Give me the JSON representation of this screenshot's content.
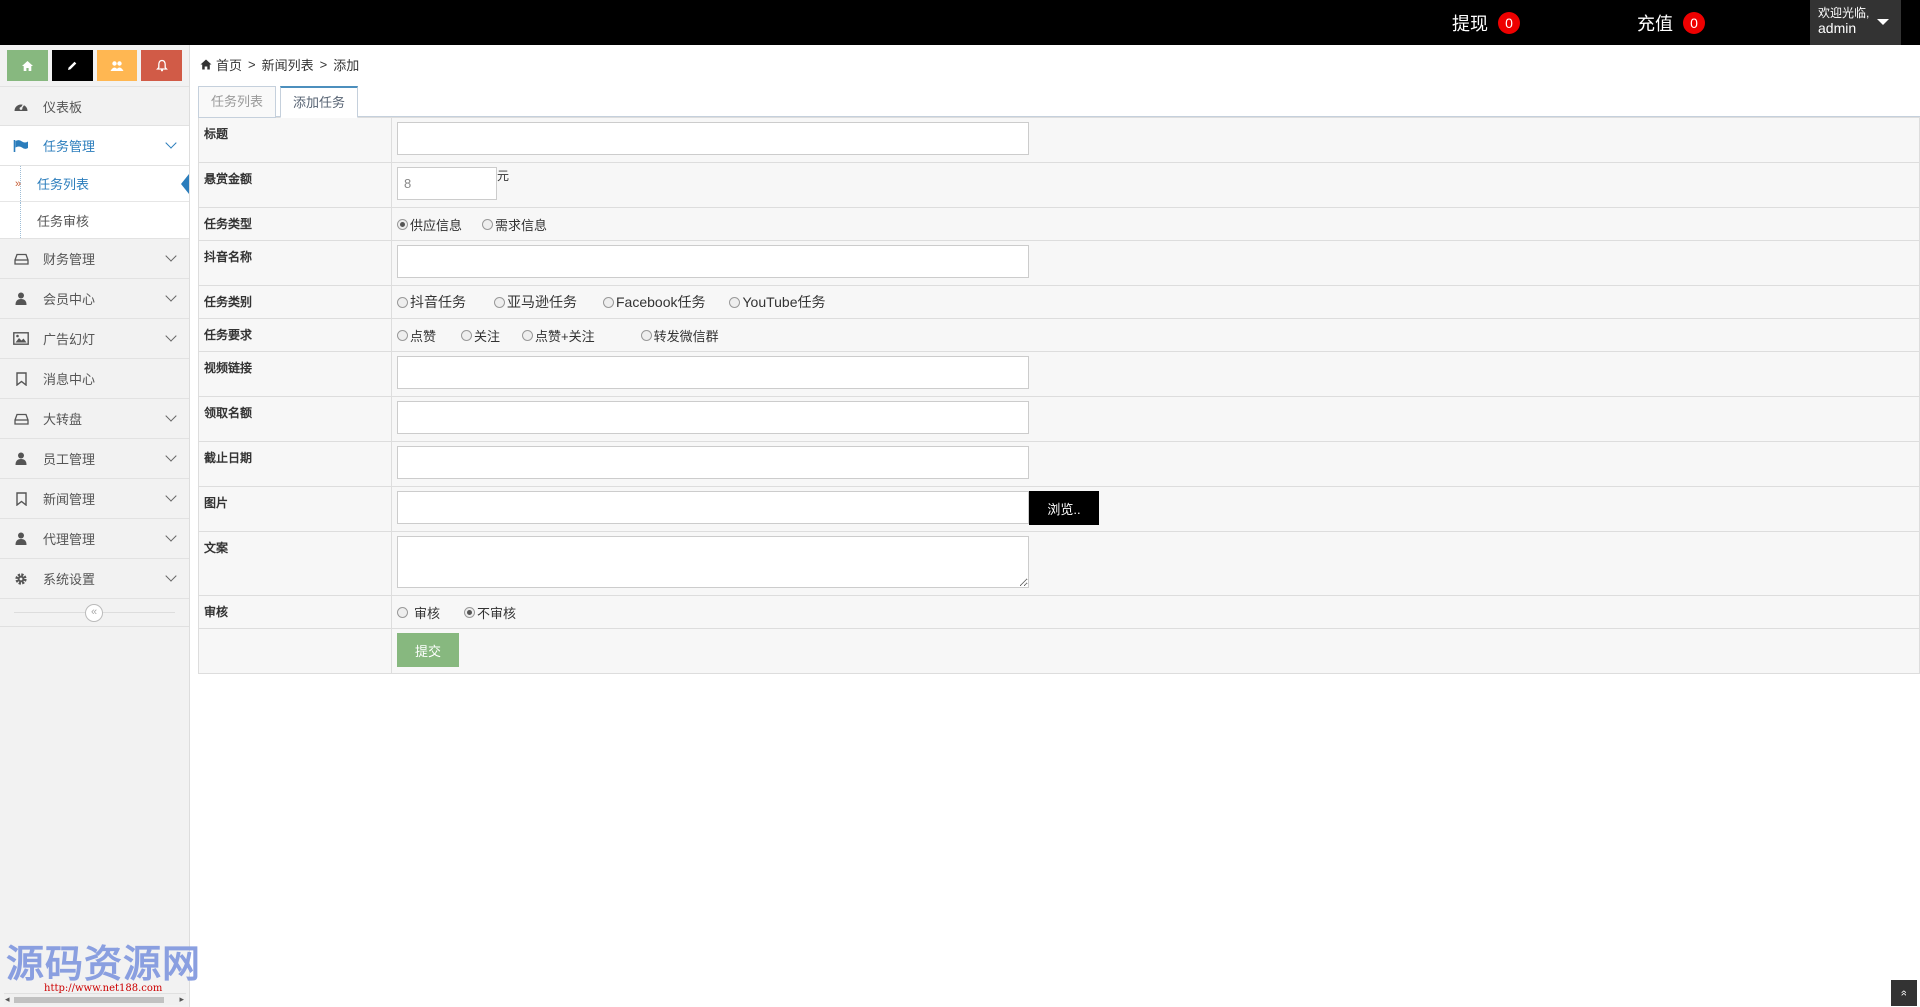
{
  "topbar": {
    "withdraw_label": "提现",
    "withdraw_count": "0",
    "recharge_label": "充值",
    "recharge_count": "0",
    "welcome": "欢迎光临,",
    "username": "admin"
  },
  "shortcuts": [
    {
      "icon": "home-icon",
      "color": "#87b87f"
    },
    {
      "icon": "pencil-icon",
      "color": "#000000"
    },
    {
      "icon": "users-icon",
      "color": "#ffb752"
    },
    {
      "icon": "bell-icon",
      "color": "#d15b47"
    }
  ],
  "sidebar": {
    "items": [
      {
        "label": "仪表板",
        "icon": "dashboard-icon"
      },
      {
        "label": "任务管理",
        "icon": "flag-icon"
      },
      {
        "label": "财务管理",
        "icon": "drive-icon"
      },
      {
        "label": "会员中心",
        "icon": "user-icon"
      },
      {
        "label": "广告幻灯",
        "icon": "picture-icon"
      },
      {
        "label": "消息中心",
        "icon": "bookmark-icon"
      },
      {
        "label": "大转盘",
        "icon": "drive-icon"
      },
      {
        "label": "员工管理",
        "icon": "user-icon"
      },
      {
        "label": "新闻管理",
        "icon": "bookmark-icon"
      },
      {
        "label": "代理管理",
        "icon": "user-icon"
      },
      {
        "label": "系统设置",
        "icon": "gear-icon"
      }
    ],
    "submenu": [
      "任务列表",
      "任务审核"
    ],
    "collapse_glyph": "«"
  },
  "watermark": {
    "title": "源码资源网",
    "url": "http://www.net188.com"
  },
  "breadcrumb": {
    "home": "首页",
    "sep": ">",
    "level1": "新闻列表",
    "level2": "添加"
  },
  "tabs": [
    "任务列表",
    "添加任务"
  ],
  "form": {
    "title_label": "标题",
    "reward_label": "悬赏金额",
    "reward_value": "8",
    "reward_unit": "元",
    "type_label": "任务类型",
    "type_options": [
      "供应信息",
      "需求信息"
    ],
    "douyin_label": "抖音名称",
    "category_label": "任务类别",
    "category_options": [
      "抖音任务",
      "亚马逊任务",
      "Facebook任务",
      "YouTube任务"
    ],
    "require_label": "任务要求",
    "require_options": [
      "点赞",
      "关注",
      "点赞+关注",
      "转发微信群"
    ],
    "video_label": "视频链接",
    "quota_label": "领取名额",
    "deadline_label": "截止日期",
    "image_label": "图片",
    "browse_label": "浏览..",
    "copy_label": "文案",
    "audit_label": "审核",
    "audit_options": [
      "审核",
      "不审核"
    ],
    "submit_label": "提交"
  },
  "to_top_glyph": "»"
}
